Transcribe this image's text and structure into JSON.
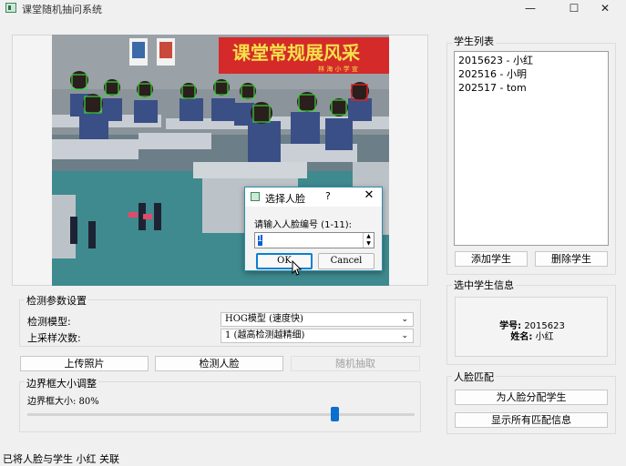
{
  "window": {
    "title": "课堂随机抽问系统",
    "minimize": "—",
    "maximize": "☐",
    "close": "✕"
  },
  "photo": {
    "banner_text": "课堂常规展风采",
    "banner_sub": "林 海 小 学 宣",
    "face_count": 11,
    "face_box_color": "#3bd23b",
    "selected_face_color": "#e02020"
  },
  "detection": {
    "group_title": "检测参数设置",
    "model_label": "检测模型:",
    "model_value": "HOG模型 (速度快)",
    "upsample_label": "上采样次数:",
    "upsample_value": "1 (越高检测越精细)"
  },
  "actions": {
    "upload": "上传照片",
    "detect": "检测人脸",
    "random": "随机抽取"
  },
  "bbox_adjust": {
    "group_title": "边界框大小调整",
    "size_label": "边界框大小: 80%",
    "size_value": 0.8
  },
  "students": {
    "group_title": "学生列表",
    "items": [
      "2015623 - 小红",
      "202516 - 小明",
      "202517 - tom"
    ],
    "add": "添加学生",
    "delete": "删除学生"
  },
  "selected_student": {
    "group_title": "选中学生信息",
    "id_label": "学号:",
    "id_value": "2015623",
    "name_label": "姓名:",
    "name_value": "小红"
  },
  "face_match": {
    "group_title": "人脸匹配",
    "assign": "为人脸分配学生",
    "show_all": "显示所有匹配信息"
  },
  "dialog": {
    "title": "选择人脸",
    "help": "?",
    "close": "✕",
    "prompt": "请输入人脸编号 (1-11):",
    "value": "1",
    "ok": "OK",
    "cancel": "Cancel"
  },
  "status_bar": {
    "text": "已将人脸与学生 小红 关联"
  },
  "colors": {
    "accent": "#0a6fd0",
    "dialog_border": "#2f8fa8",
    "banner_red": "#d42a2a"
  }
}
